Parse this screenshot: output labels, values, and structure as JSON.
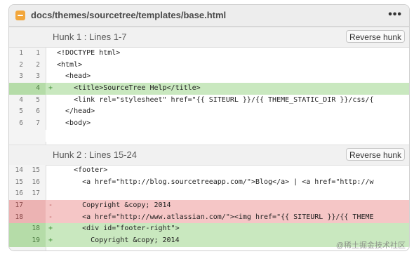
{
  "header": {
    "file_path": "docs/themes/sourcetree/templates/base.html",
    "more_icon": "•••"
  },
  "hunks": [
    {
      "title": "Hunk 1 : Lines 1-7",
      "reverse_label": "Reverse hunk",
      "lines": [
        {
          "type": "context",
          "old": "1",
          "new": "1",
          "marker": "",
          "code": "<!DOCTYPE html>"
        },
        {
          "type": "context",
          "old": "2",
          "new": "2",
          "marker": "",
          "code": "<html>"
        },
        {
          "type": "context",
          "old": "3",
          "new": "3",
          "marker": "",
          "code": "  <head>"
        },
        {
          "type": "added",
          "old": "",
          "new": "4",
          "marker": "+",
          "code": "    <title>SourceTree Help</title>"
        },
        {
          "type": "context",
          "old": "4",
          "new": "5",
          "marker": "",
          "code": "    <link rel=\"stylesheet\" href=\"{{ SITEURL }}/{{ THEME_STATIC_DIR }}/css/{"
        },
        {
          "type": "context",
          "old": "5",
          "new": "6",
          "marker": "",
          "code": "  </head>"
        },
        {
          "type": "context",
          "old": "6",
          "new": "7",
          "marker": "",
          "code": "  <body>"
        }
      ]
    },
    {
      "title": "Hunk 2 : Lines 15-24",
      "reverse_label": "Reverse hunk",
      "lines": [
        {
          "type": "context",
          "old": "14",
          "new": "15",
          "marker": "",
          "code": "    <footer>"
        },
        {
          "type": "context",
          "old": "15",
          "new": "16",
          "marker": "",
          "code": "      <a href=\"http://blog.sourcetreeapp.com/\">Blog</a> | <a href=\"http://w"
        },
        {
          "type": "context",
          "old": "16",
          "new": "17",
          "marker": "",
          "code": ""
        },
        {
          "type": "removed",
          "old": "17",
          "new": "",
          "marker": "-",
          "code": "      Copyright &copy; 2014"
        },
        {
          "type": "removed",
          "old": "18",
          "new": "",
          "marker": "-",
          "code": "      <a href=\"http://www.atlassian.com/\"><img href=\"{{ SITEURL }}/{{ THEME"
        },
        {
          "type": "added",
          "old": "",
          "new": "18",
          "marker": "+",
          "code": "      <div id=\"footer-right\">"
        },
        {
          "type": "added",
          "old": "",
          "new": "19",
          "marker": "+",
          "code": "        Copyright &copy; 2014"
        }
      ]
    }
  ],
  "watermark": "@稀土掘金技术社区",
  "colors": {
    "added_bg": "#c9e8bf",
    "removed_bg": "#f5c6c6",
    "file_icon": "#f2a63b"
  }
}
